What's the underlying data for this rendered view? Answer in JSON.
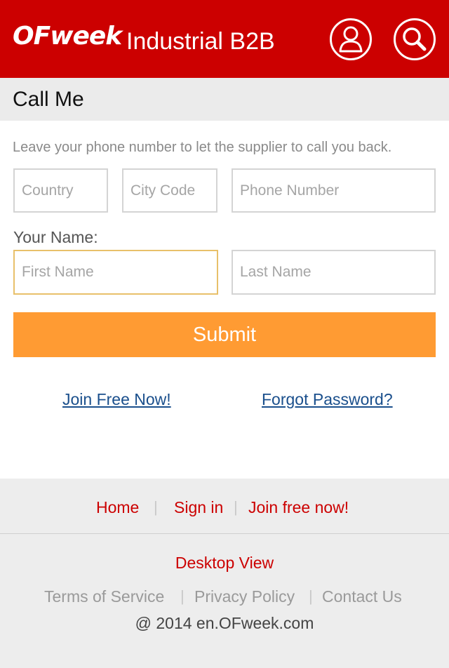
{
  "header": {
    "logo_text": "OFweek",
    "site_name": "Industrial B2B",
    "user_icon": "user-icon",
    "search_icon": "search-icon",
    "brand_color": "#cc0000"
  },
  "section": {
    "title": "Call Me"
  },
  "form": {
    "intro": "Leave your phone number to let the supplier to call you back.",
    "country_placeholder": "Country",
    "city_placeholder": "City Code",
    "phone_placeholder": "Phone Number",
    "name_label": "Your Name:",
    "first_placeholder": "First Name",
    "last_placeholder": "Last Name",
    "submit_label": "Submit",
    "submit_color": "#ff9b33"
  },
  "links": {
    "join": "Join Free Now!",
    "forgot": "Forgot Password?"
  },
  "footer": {
    "nav": [
      "Home",
      "Sign in",
      "Join free now!"
    ],
    "separator": "|",
    "desktop_view": "Desktop View",
    "legal": [
      "Terms of Service",
      "Privacy Policy",
      "Contact Us"
    ],
    "copyright": "@ 2014 en.OFweek.com"
  }
}
